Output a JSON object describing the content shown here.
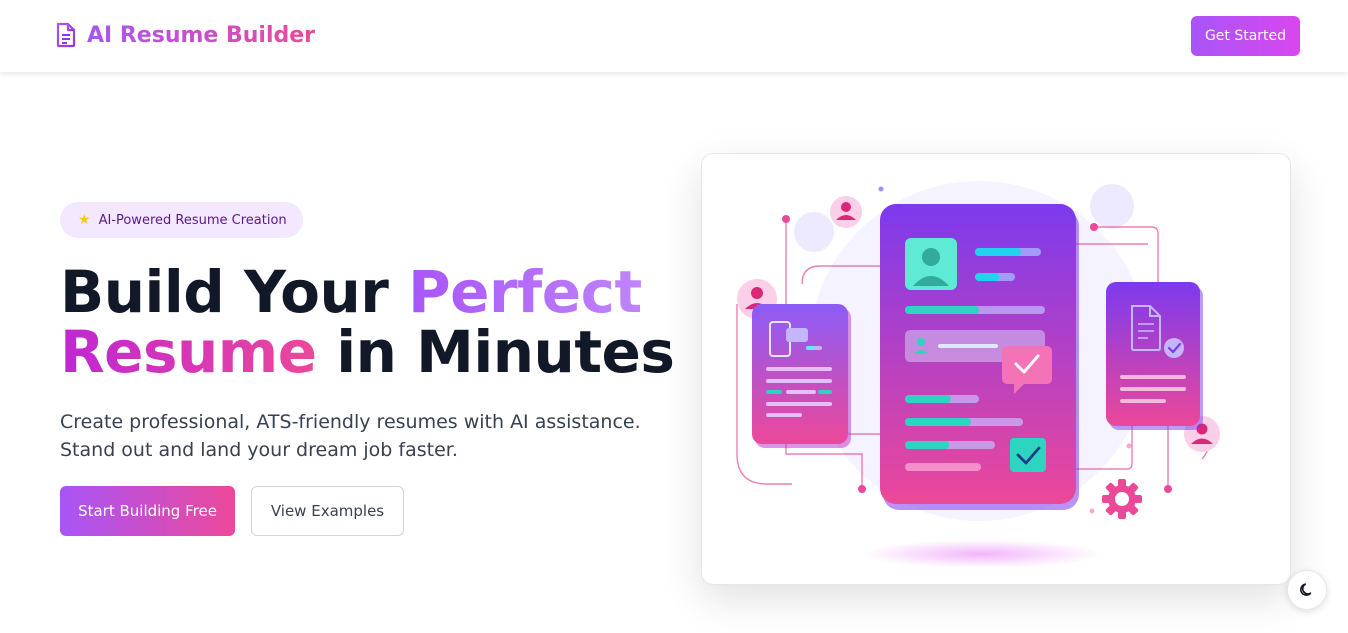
{
  "header": {
    "brand_name": "AI Resume Builder",
    "brand_icon": "document-icon",
    "cta_label": "Get Started"
  },
  "hero": {
    "badge_icon": "star-icon",
    "badge_text": "AI-Powered Resume Creation",
    "title_part1": "Build Your ",
    "title_highlight1": "Perfect",
    "title_highlight2": "Resume",
    "title_part2": " in Minutes",
    "subtitle": "Create professional, ATS-friendly resumes with AI assistance. Stand out and land your dream job faster.",
    "primary_button": "Start Building Free",
    "secondary_button": "View Examples"
  },
  "illustration": {
    "subject": "resume-builder-illustration",
    "icons": [
      "profile-icon",
      "phone-icon",
      "document-check-icon",
      "checkmark-icon",
      "gear-icon",
      "user-icon"
    ]
  },
  "theme_toggle": {
    "icon": "moon-icon"
  },
  "colors": {
    "brand_purple": "#a855f7",
    "brand_pink": "#ec4899",
    "heading_dark": "#111827",
    "badge_bg": "#f3e8ff"
  }
}
